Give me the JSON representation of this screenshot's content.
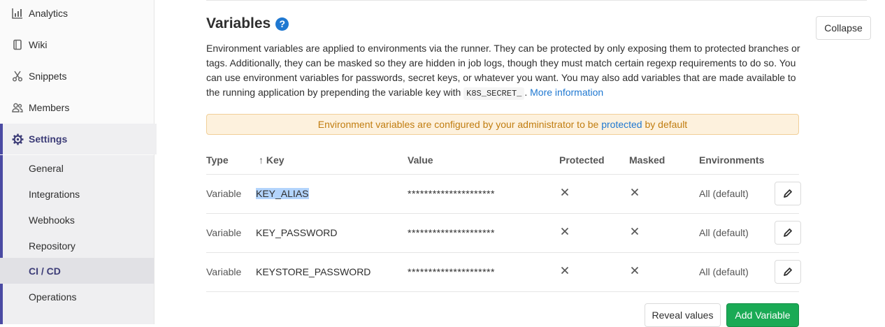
{
  "sidebar": {
    "items": [
      {
        "label": "Analytics",
        "icon": "analytics-icon"
      },
      {
        "label": "Wiki",
        "icon": "book-icon"
      },
      {
        "label": "Snippets",
        "icon": "scissors-icon"
      },
      {
        "label": "Members",
        "icon": "users-icon"
      },
      {
        "label": "Settings",
        "icon": "gear-icon"
      }
    ],
    "settings_sub": [
      {
        "label": "General"
      },
      {
        "label": "Integrations"
      },
      {
        "label": "Webhooks"
      },
      {
        "label": "Repository"
      },
      {
        "label": "CI / CD"
      },
      {
        "label": "Operations"
      }
    ]
  },
  "section": {
    "title": "Variables",
    "help_glyph": "?",
    "collapse_label": "Collapse",
    "description_part1": "Environment variables are applied to environments via the runner. They can be protected by only exposing them to protected branches or tags. Additionally, they can be masked so they are hidden in job logs, though they must match certain regexp requirements to do so. You can use environment variables for passwords, secret keys, or whatever you want. You may also add variables that are made available to the running application by prepending the variable key with",
    "description_code": "K8S_SECRET_",
    "description_part2": ".",
    "more_info_link": "More information"
  },
  "alert": {
    "before": "Environment variables are configured by your administrator to be",
    "link": "protected",
    "after": "by default"
  },
  "table": {
    "headers": {
      "type": "Type",
      "key": "↑ Key",
      "value": "Value",
      "protected": "Protected",
      "masked": "Masked",
      "environments": "Environments"
    },
    "rows": [
      {
        "type": "Variable",
        "key": "KEY_ALIAS",
        "value": "*********************",
        "environments": "All (default)"
      },
      {
        "type": "Variable",
        "key": "KEY_PASSWORD",
        "value": "*********************",
        "environments": "All (default)"
      },
      {
        "type": "Variable",
        "key": "KEYSTORE_PASSWORD",
        "value": "*********************",
        "environments": "All (default)"
      }
    ]
  },
  "actions": {
    "reveal_label": "Reveal values",
    "add_label": "Add Variable"
  },
  "colors": {
    "accent": "#1f78d1",
    "success": "#1aaa55",
    "warning_bg": "#fdf1dd",
    "warning_text": "#c17d10",
    "nav_active": "#3c3c77"
  }
}
